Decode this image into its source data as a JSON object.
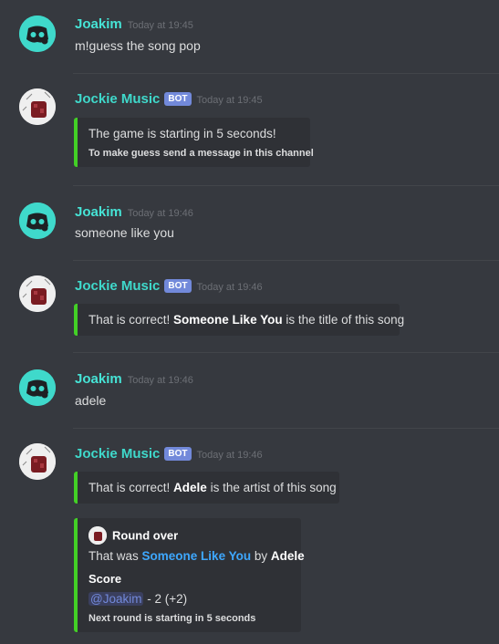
{
  "colors": {
    "background": "#36393f",
    "embed_bg": "#2f3136",
    "embed_accent": "#43d026",
    "user_name": "#46e4d6",
    "bot_tag": "#7289da",
    "link": "#3ea8ff"
  },
  "messages": [
    {
      "author": "Joakim",
      "time": "Today at 19:45",
      "text": "m!guess the song pop",
      "avatar_icon": "discord-logo-icon"
    },
    {
      "author": "Jockie Music",
      "tag": "BOT",
      "time": "Today at 19:45",
      "avatar_icon": "bot-avatar-icon",
      "embed": {
        "description": "The game is starting in 5 seconds!",
        "footer": "To make guess send a message in this channel"
      }
    },
    {
      "author": "Joakim",
      "time": "Today at 19:46",
      "text": "someone like you",
      "avatar_icon": "discord-logo-icon"
    },
    {
      "author": "Jockie Music",
      "tag": "BOT",
      "time": "Today at 19:46",
      "avatar_icon": "bot-avatar-icon",
      "embed": {
        "prefix": "That is correct!",
        "bold": "Someone Like You",
        "suffix": "is the title of this song"
      }
    },
    {
      "author": "Joakim",
      "time": "Today at 19:46",
      "text": "adele",
      "avatar_icon": "discord-logo-icon"
    },
    {
      "author": "Jockie Music",
      "tag": "BOT",
      "time": "Today at 19:46",
      "avatar_icon": "bot-avatar-icon",
      "embed": {
        "prefix": "That is correct!",
        "bold": "Adele",
        "suffix": "is the artist of this song"
      },
      "embed2": {
        "author": "Round over",
        "desc_prefix": "That was",
        "song": "Someone Like You",
        "desc_mid": "by",
        "artist": "Adele",
        "field_name": "Score",
        "mention": "@Joakim",
        "score": "- 2 (+2)",
        "footer": "Next round is starting in 5 seconds"
      }
    }
  ]
}
